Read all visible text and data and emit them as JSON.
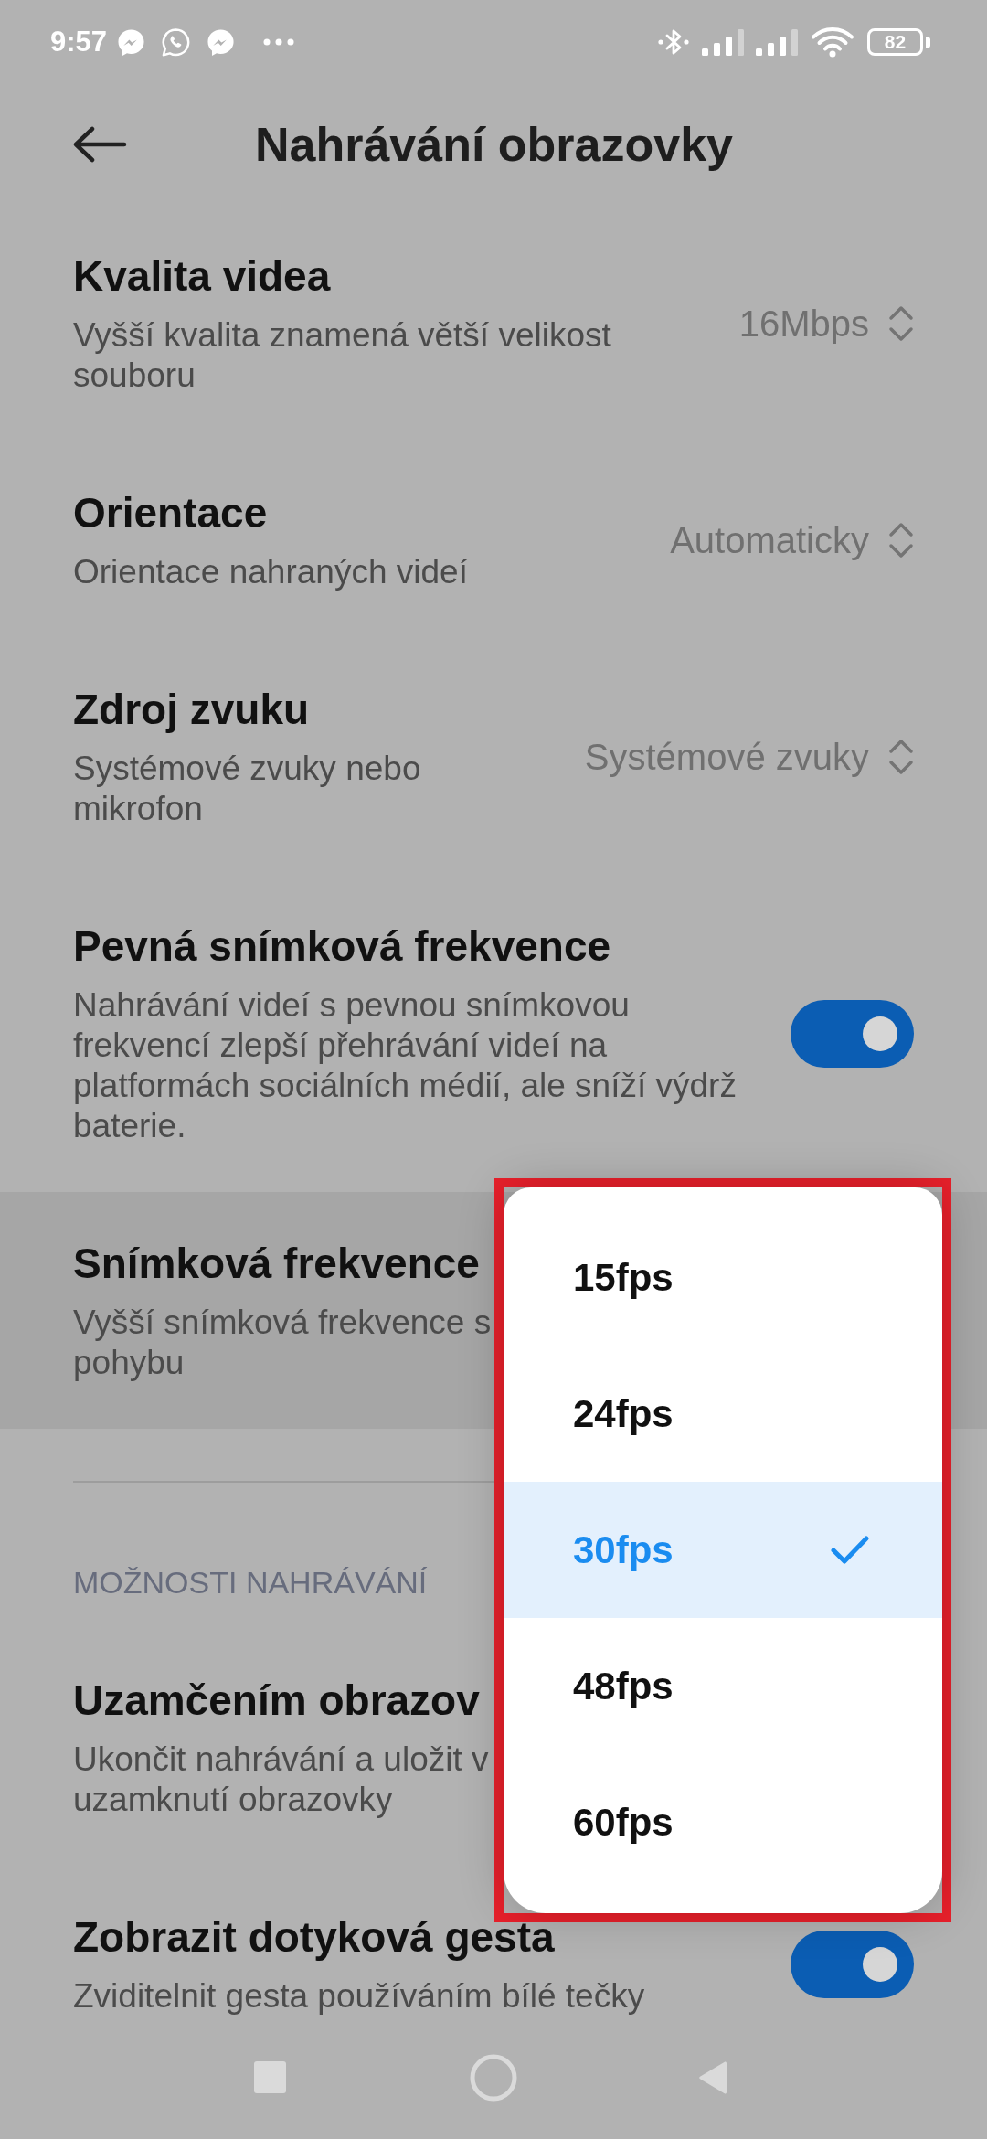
{
  "status_bar": {
    "time": "9:57",
    "battery": "82"
  },
  "header": {
    "title": "Nahrávání obrazovky"
  },
  "sections": [
    {
      "items": [
        {
          "kind": "select",
          "title": "Kvalita videa",
          "description": "Vyšší kvalita znamená větší velikost\nsouboru",
          "value": "16Mbps",
          "expanded": false
        },
        {
          "kind": "select",
          "title": "Orientace",
          "description": "Orientace nahraných videí",
          "value": "Automaticky",
          "expanded": false
        },
        {
          "kind": "select",
          "title": "Zdroj zvuku",
          "description": "Systémové zvuky nebo\nmikrofon",
          "value": "Systémové zvuky",
          "expanded": false
        },
        {
          "kind": "toggle",
          "title": "Pevná snímková frekvence",
          "description": "Nahrávání videí s pevnou snímkovou\nfrekvencí zlepší přehrávání videí na\nplatformách sociálních médií, ale sníží výdrž\nbaterie.",
          "on": true,
          "expanded": false
        },
        {
          "kind": "select",
          "title": "Snímková frekvence",
          "description": "Vyšší snímková frekvence s\npohybu",
          "expanded": true
        }
      ]
    },
    {
      "header": "MOŽNOSTI NAHRÁVÁNÍ",
      "items": [
        {
          "kind": "text",
          "title": "Uzamčením obrazov",
          "description": "Ukončit nahrávání a uložit v\nuzamknutí obrazovky",
          "expanded": false
        },
        {
          "kind": "toggle",
          "title": "Zobrazit dotyková gesta",
          "description": "Zviditelnit gesta používáním bílé tečky",
          "on": true,
          "expanded": false
        }
      ]
    }
  ],
  "dropdown": {
    "options": [
      {
        "label": "15fps",
        "selected": false
      },
      {
        "label": "24fps",
        "selected": false
      },
      {
        "label": "30fps",
        "selected": true
      },
      {
        "label": "48fps",
        "selected": false
      },
      {
        "label": "60fps",
        "selected": false
      }
    ]
  }
}
